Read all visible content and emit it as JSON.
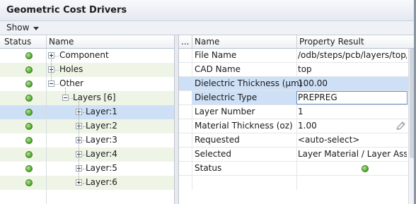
{
  "window": {
    "title": "Geometric Cost Drivers"
  },
  "toolbar": {
    "show_label": "Show"
  },
  "left_header": {
    "status": "Status",
    "name": "Name"
  },
  "right_header": {
    "dots": "...",
    "name": "Name",
    "result": "Property Result"
  },
  "tree": [
    {
      "label": "Component",
      "expander": "plus"
    },
    {
      "label": "Holes",
      "expander": "plus"
    },
    {
      "label": "Other",
      "expander": "minus"
    },
    {
      "label": "Layers [6]",
      "expander": "minus"
    },
    {
      "label": "Layer:1",
      "expander": "plus"
    },
    {
      "label": "Layer:2",
      "expander": "plus"
    },
    {
      "label": "Layer:3",
      "expander": "plus"
    },
    {
      "label": "Layer:4",
      "expander": "plus"
    },
    {
      "label": "Layer:5",
      "expander": "plus"
    },
    {
      "label": "Layer:6",
      "expander": "plus"
    }
  ],
  "properties": [
    {
      "name": "File Name",
      "value": "/odb/steps/pcb/layers/top/"
    },
    {
      "name": "CAD Name",
      "value": "top"
    },
    {
      "name": "Dielectric Thickness (µm)",
      "value": "100.00"
    },
    {
      "name": "Dielectric Type",
      "value": "PREPREG"
    },
    {
      "name": "Layer Number",
      "value": "1"
    },
    {
      "name": "Material Thickness (oz)",
      "value": "1.00"
    },
    {
      "name": "Requested",
      "value": "<auto-select>"
    },
    {
      "name": "Selected",
      "value": "Layer Material / Layer Asse..."
    },
    {
      "name": "Status",
      "value": ""
    }
  ],
  "colors": {
    "selection": "#cde0f6",
    "row_alt": "#eef5e6",
    "status_ok": "#4ea22c"
  }
}
